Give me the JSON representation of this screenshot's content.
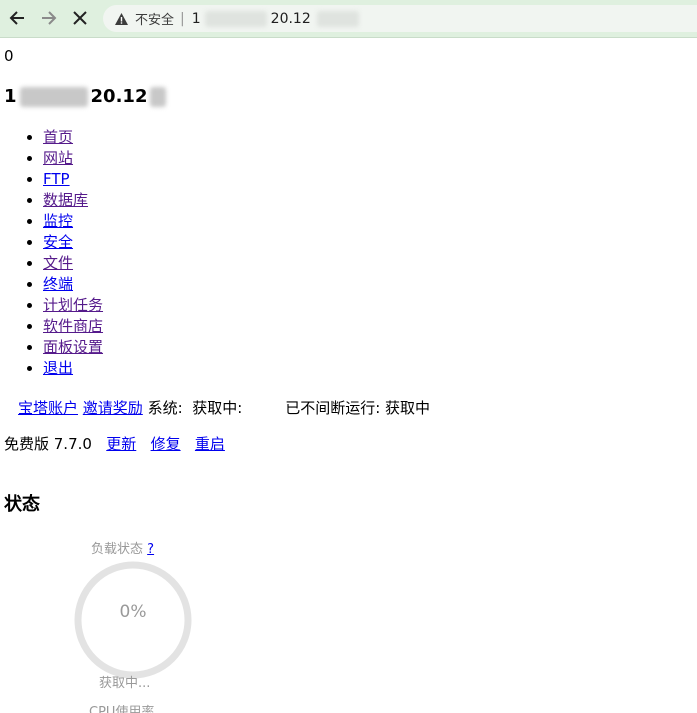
{
  "browser": {
    "insecure_label": "不安全",
    "separator": "|",
    "url_prefix": "1",
    "url_visible": "20.12",
    "icons": {
      "back": "back-arrow-icon",
      "forward": "forward-arrow-icon",
      "stop": "close-icon",
      "warning": "warning-triangle-icon"
    }
  },
  "page": {
    "counter": "0",
    "host_prefix": "1",
    "host_visible": "20.12"
  },
  "nav": {
    "items": [
      {
        "label": "首页"
      },
      {
        "label": "网站"
      },
      {
        "label": "FTP"
      },
      {
        "label": "数据库"
      },
      {
        "label": "监控"
      },
      {
        "label": "安全"
      },
      {
        "label": "文件"
      },
      {
        "label": "终端"
      },
      {
        "label": "计划任务"
      },
      {
        "label": "软件商店"
      },
      {
        "label": "面板设置"
      },
      {
        "label": "退出"
      }
    ]
  },
  "infobar": {
    "account_link": "宝塔账户",
    "invite_link": "邀请奖励",
    "system_label": "系统:",
    "system_value": "获取中:",
    "uptime_label": "已不间断运行:",
    "uptime_value": "获取中"
  },
  "version": {
    "edition": "免费版 7.7.0",
    "update_link": "更新",
    "repair_link": "修复",
    "restart_link": "重启"
  },
  "status": {
    "heading": "状态",
    "load_label": "负载状态",
    "help_link": "?",
    "load_percent": "0%",
    "load_value": 0,
    "fetching": "获取中...",
    "cpu_label": "CPU使用率"
  },
  "colors": {
    "link": "#0000ee",
    "visited": "#551a8b",
    "muted": "#999999",
    "gauge_track": "#e3e3e3",
    "chrome_bg": "#dff0df"
  }
}
